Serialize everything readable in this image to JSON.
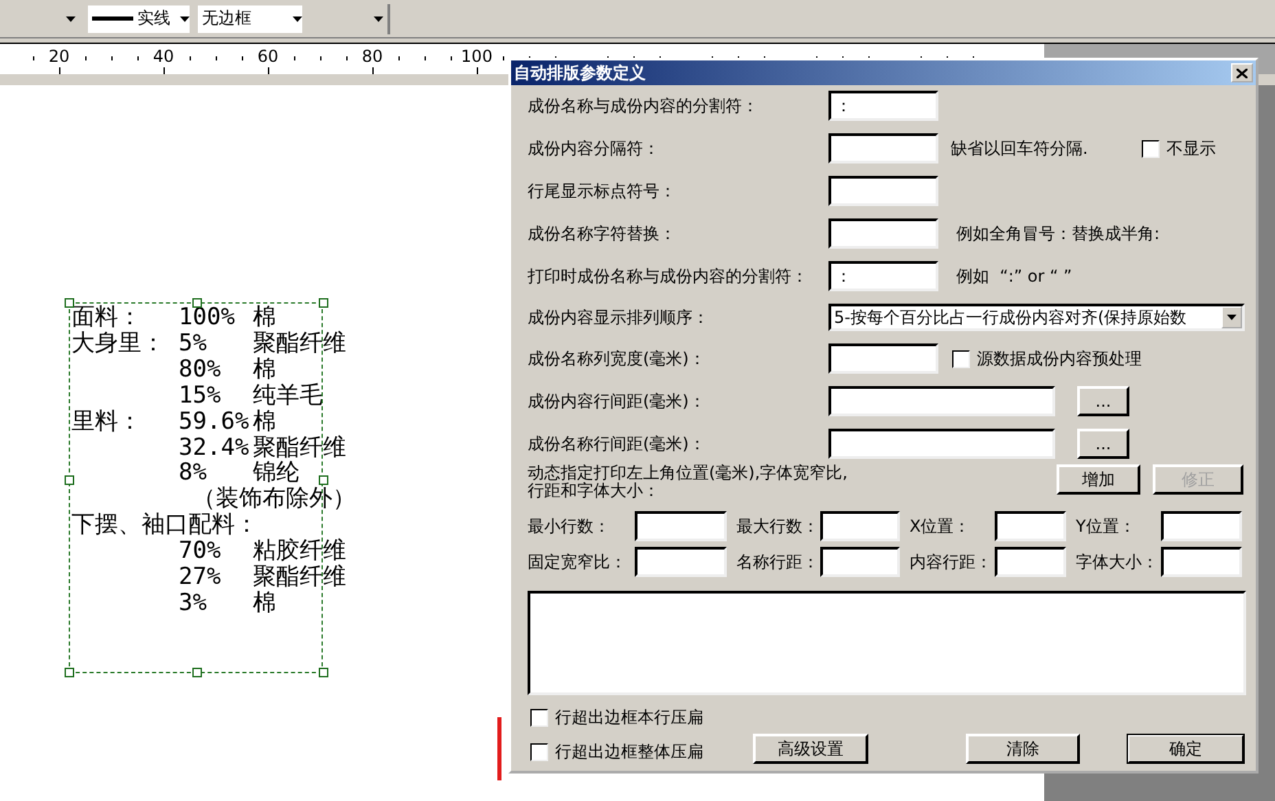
{
  "toolbar": {
    "line_style": "实线",
    "border_style": "无边框"
  },
  "ruler": {
    "labels": [
      "20",
      "40",
      "60",
      "80",
      "100"
    ]
  },
  "composition_block": {
    "lines": [
      {
        "kind": "entry",
        "label": "面料：",
        "percent": "100%",
        "material": "棉"
      },
      {
        "kind": "entry",
        "label": "大身里：",
        "percent": "5%",
        "material": "聚酯纤维"
      },
      {
        "kind": "entry",
        "percent": "80%",
        "material": "棉"
      },
      {
        "kind": "entry",
        "percent": "15%",
        "material": "纯羊毛"
      },
      {
        "kind": "entry",
        "label": "里料：",
        "percent": "59.6%",
        "material": "棉"
      },
      {
        "kind": "entry",
        "percent": "32.4%",
        "material": "聚酯纤维"
      },
      {
        "kind": "entry",
        "percent": "8%",
        "material": "锦纶"
      },
      {
        "kind": "note",
        "text": "（装饰布除外）"
      },
      {
        "kind": "heading",
        "label": "下摆、袖口配料："
      },
      {
        "kind": "entry",
        "percent": "70%",
        "material": "粘胶纤维"
      },
      {
        "kind": "entry",
        "percent": "27%",
        "material": "聚酯纤维"
      },
      {
        "kind": "entry",
        "percent": "3%",
        "material": "棉"
      }
    ]
  },
  "dialog": {
    "title": "自动排版参数定义",
    "rows": [
      {
        "kind": "text",
        "label": "成份名称与成份内容的分割符：",
        "value": "："
      },
      {
        "kind": "text",
        "label": "成份内容分隔符：",
        "note": "缺省以回车符分隔.",
        "checkbox": {
          "label": "不显示",
          "checked": false
        }
      },
      {
        "kind": "text",
        "label": "行尾显示标点符号："
      },
      {
        "kind": "text",
        "label": "成份名称字符替换：",
        "note": "例如全角冒号：替换成半角:"
      },
      {
        "kind": "text",
        "label": "打印时成份名称与成份内容的分割符：",
        "value": "：",
        "note": "例如  “:” or “ ”"
      },
      {
        "kind": "select",
        "label": "成份内容显示排列顺序：",
        "value": "5-按每个百分比占一行成份内容对齐(保持原始数"
      },
      {
        "kind": "text",
        "label": "成份名称列宽度(毫米)：",
        "checkbox": {
          "label": "源数据成份内容预处理",
          "checked": false
        }
      },
      {
        "kind": "wide",
        "label": "成份内容行间距(毫米)：",
        "button": "..."
      },
      {
        "kind": "wide",
        "label": "成份名称行间距(毫米)：",
        "button": "..."
      }
    ],
    "dynamic": {
      "label": "动态指定打印左上角位置(毫米),字体宽窄比,\n行距和字体大小：",
      "buttons": [
        {
          "label": "增加",
          "disabled": false
        },
        {
          "label": "修正",
          "disabled": true
        }
      ]
    },
    "params": [
      {
        "label": "最小行数："
      },
      {
        "label": "最大行数："
      },
      {
        "label": "X位置："
      },
      {
        "label": "Y位置："
      },
      {
        "label": "固定宽窄比："
      },
      {
        "label": "名称行距："
      },
      {
        "label": "内容行距："
      },
      {
        "label": "字体大小："
      }
    ],
    "options": [
      {
        "label": "行超出边框本行压扁",
        "checked": false
      },
      {
        "label": "行超出边框整体压扁",
        "checked": false
      }
    ],
    "buttons": [
      {
        "label": "高级设置",
        "default": false
      },
      {
        "label": "清除",
        "default": false
      },
      {
        "label": "确定",
        "default": true
      }
    ]
  }
}
